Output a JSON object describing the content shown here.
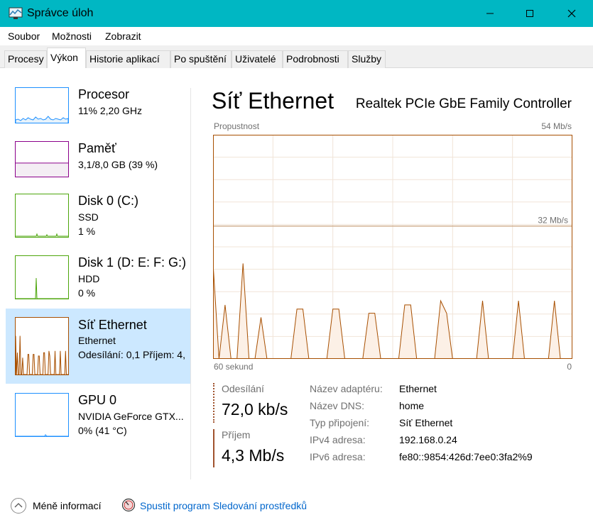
{
  "window": {
    "title": "Správce úloh",
    "minimize_icon": "minimize-icon",
    "maximize_icon": "maximize-icon",
    "close_icon": "close-icon"
  },
  "menu": [
    "Soubor",
    "Možnosti",
    "Zobrazit"
  ],
  "tabs": [
    "Procesy",
    "Výkon",
    "Historie aplikací",
    "Po spuštění",
    "Uživatelé",
    "Podrobnosti",
    "Služby"
  ],
  "active_tab": "Výkon",
  "sidebar": [
    {
      "title": "Procesor",
      "line1": "11% 2,20 GHz",
      "line2": "",
      "color": "#1e90ff"
    },
    {
      "title": "Paměť",
      "line1": "3,1/8,0 GB (39 %)",
      "line2": "",
      "color": "#8b008b",
      "fill": 0.39
    },
    {
      "title": "Disk 0 (C:)",
      "line1": "SSD",
      "line2": "1 %",
      "color": "#4da60c"
    },
    {
      "title": "Disk 1 (D: E: F: G:)",
      "line1": "HDD",
      "line2": "0 %",
      "color": "#4da60c"
    },
    {
      "title": "Síť Ethernet",
      "line1": "Ethernet",
      "line2": "Odesílání: 0,1 Příjem: 4,",
      "color": "#a74f01",
      "selected": true
    },
    {
      "title": "GPU 0",
      "line1": "NVIDIA GeForce GTX...",
      "line2": "0% (41 °C)",
      "color": "#1e90ff"
    }
  ],
  "header": {
    "title": "Síť Ethernet",
    "subtitle": "Realtek PCIe GbE Family Controller"
  },
  "chart_data": {
    "type": "area",
    "title": "Propustnost",
    "y_max_label": "54 Mb/s",
    "y_mid_label": "32 Mb/s",
    "x_left_label": "60 sekund",
    "x_right_label": "0",
    "ylim": [
      0,
      54
    ],
    "reference_line": 32,
    "x": [
      0,
      1,
      2,
      3,
      4,
      5,
      6,
      7,
      8,
      9,
      10,
      11,
      12,
      13,
      14,
      15,
      16,
      17,
      18,
      19,
      20,
      21,
      22,
      23,
      24,
      25,
      26,
      27,
      28,
      29,
      30,
      31,
      32,
      33,
      34,
      35,
      36,
      37,
      38,
      39,
      40,
      41,
      42,
      43,
      44,
      45,
      46,
      47,
      48,
      49,
      50,
      51,
      52,
      53,
      54,
      55,
      56,
      57,
      58,
      59,
      60
    ],
    "values": [
      23,
      0,
      13,
      0,
      0,
      23,
      0,
      0,
      10,
      0,
      0,
      0,
      0,
      0,
      12,
      12,
      0,
      0,
      0,
      0,
      12,
      12,
      0,
      0,
      0,
      0,
      11,
      11,
      0,
      0,
      0,
      0,
      13,
      13,
      0,
      0,
      0,
      0,
      14,
      11,
      0,
      0,
      0,
      0,
      0,
      14,
      0,
      0,
      0,
      0,
      0,
      14,
      0,
      0,
      0,
      0,
      0,
      14,
      0,
      0,
      0
    ],
    "color": "#a74f01",
    "fill_color": "#fcf0e6"
  },
  "stats": {
    "send_label": "Odesílání",
    "send_value": "72,0 kb/s",
    "recv_label": "Příjem",
    "recv_value": "4,3 Mb/s"
  },
  "properties": [
    {
      "label": "Název adaptéru:",
      "value": "Ethernet"
    },
    {
      "label": "Název DNS:",
      "value": "home"
    },
    {
      "label": "Typ připojení:",
      "value": "Síť Ethernet"
    },
    {
      "label": "IPv4 adresa:",
      "value": "192.168.0.24"
    },
    {
      "label": "IPv6 adresa:",
      "value": "fe80::9854:426d:7ee0:3fa2%9"
    }
  ],
  "footer": {
    "less_label": "Méně informací",
    "monitor_link": "Spustit program Sledování prostředků"
  }
}
